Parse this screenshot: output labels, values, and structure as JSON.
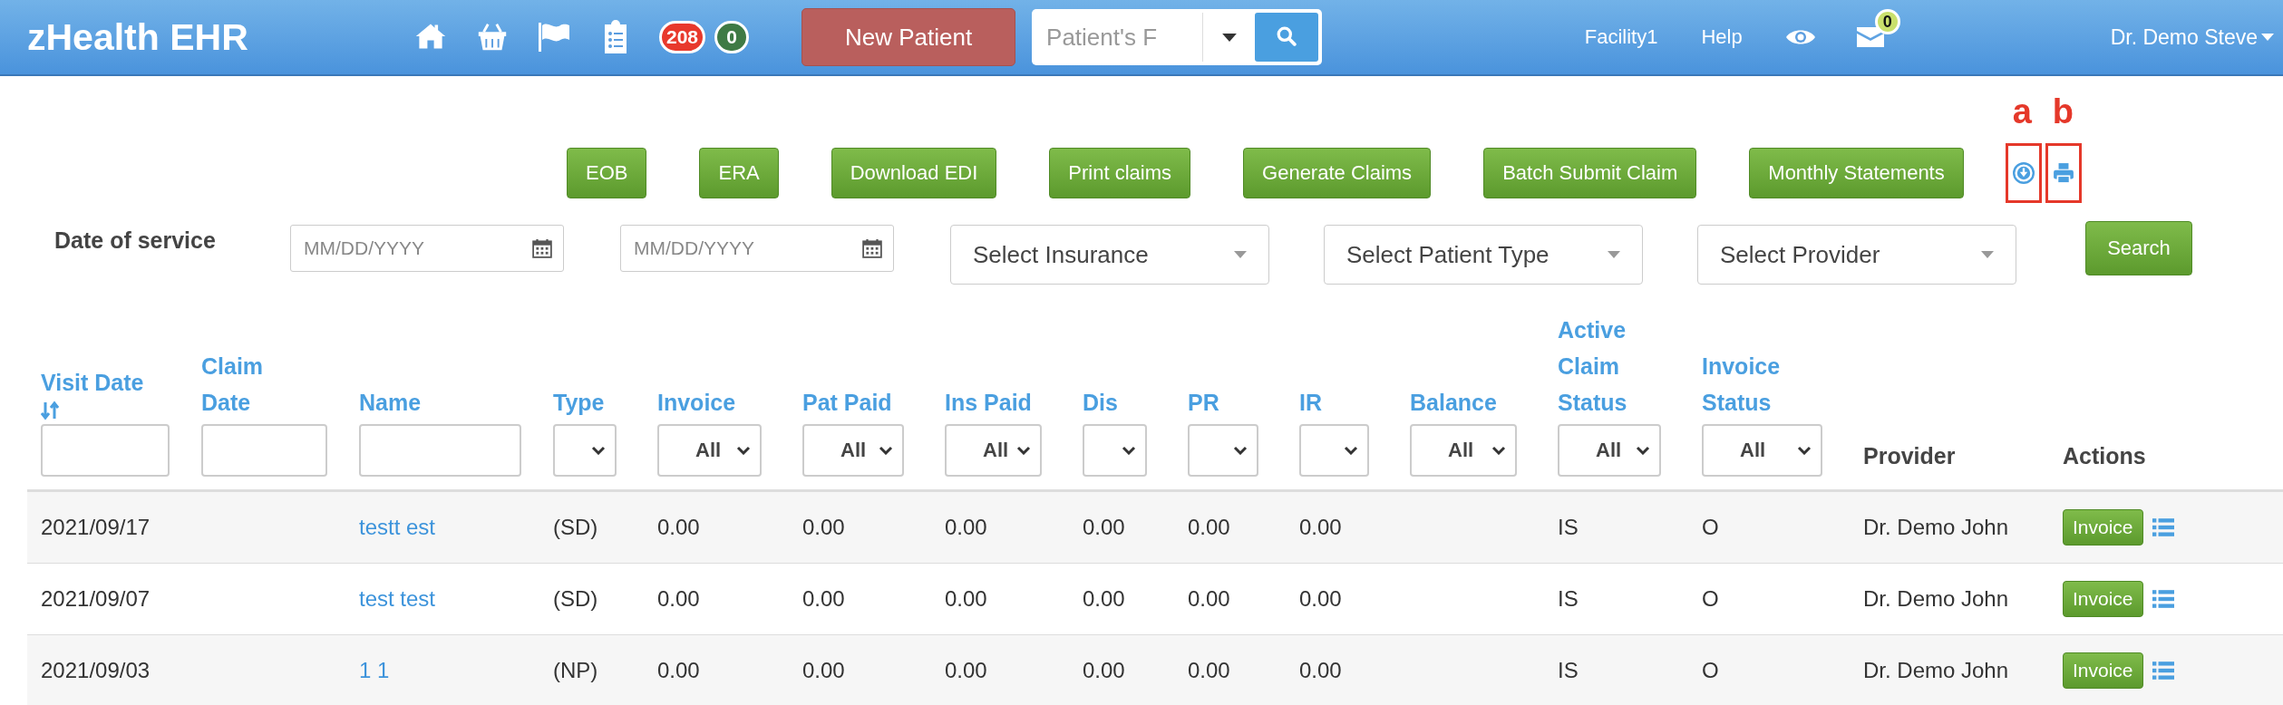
{
  "header": {
    "logo": "zHealth EHR",
    "badges": [
      {
        "text": "208",
        "color": "#e8392c"
      },
      {
        "text": "0",
        "color": "#3f7a45"
      }
    ],
    "new_patient_button": "New Patient",
    "search": {
      "placeholder": "Patient's F"
    },
    "facility": "Facility1",
    "help": "Help",
    "mail_badge": "0",
    "user": "Dr. Demo Steve"
  },
  "toolbar": {
    "buttons": [
      "EOB",
      "ERA",
      "Download EDI",
      "Print claims",
      "Generate Claims",
      "Batch Submit Claim",
      "Monthly Statements"
    ],
    "annotations": [
      {
        "label": "a",
        "kind": "download"
      },
      {
        "label": "b",
        "kind": "print"
      }
    ]
  },
  "filters": {
    "date_label": "Date of service",
    "date_fields": [
      {
        "placeholder": "MM/DD/YYYY"
      },
      {
        "placeholder": "MM/DD/YYYY"
      }
    ],
    "selects": [
      {
        "placeholder": "Select Insurance"
      },
      {
        "placeholder": "Select Patient Type"
      },
      {
        "placeholder": "Select Provider"
      }
    ],
    "search_button": "Search"
  },
  "table": {
    "columns": [
      {
        "label": "Visit Date",
        "link": true,
        "sort_icon": true,
        "filter": {
          "kind": "text"
        }
      },
      {
        "label": "Claim Date",
        "link": true,
        "sort_icon": false,
        "filter": {
          "kind": "text"
        }
      },
      {
        "label": "Name",
        "link": true,
        "sort_icon": false,
        "filter": {
          "kind": "text"
        }
      },
      {
        "label": "Type",
        "link": true,
        "sort_icon": false,
        "filter": {
          "kind": "select"
        }
      },
      {
        "label": "Invoice",
        "link": true,
        "sort_icon": false,
        "filter": {
          "kind": "select",
          "value": "All"
        }
      },
      {
        "label": "Pat Paid",
        "link": true,
        "sort_icon": false,
        "filter": {
          "kind": "select",
          "value": "All"
        }
      },
      {
        "label": "Ins Paid",
        "link": true,
        "sort_icon": false,
        "filter": {
          "kind": "select",
          "value": "All"
        }
      },
      {
        "label": "Dis",
        "link": true,
        "sort_icon": false,
        "filter": {
          "kind": "select"
        }
      },
      {
        "label": "PR",
        "link": true,
        "sort_icon": false,
        "filter": {
          "kind": "select"
        }
      },
      {
        "label": "IR",
        "link": true,
        "sort_icon": false,
        "filter": {
          "kind": "select"
        }
      },
      {
        "label": "Balance",
        "link": true,
        "sort_icon": false,
        "filter": {
          "kind": "select",
          "value": "All"
        }
      },
      {
        "label": "Active Claim Status",
        "link": true,
        "sort_icon": false,
        "filter": {
          "kind": "select",
          "value": "All"
        }
      },
      {
        "label": "Invoice Status",
        "link": true,
        "sort_icon": false,
        "filter": {
          "kind": "select",
          "value": "All"
        }
      },
      {
        "label": "Provider",
        "link": false,
        "sort_icon": false,
        "filter": {
          "kind": "none"
        }
      },
      {
        "label": "Actions",
        "link": false,
        "sort_icon": false,
        "filter": {
          "kind": "none"
        }
      }
    ],
    "rows": [
      {
        "cells": [
          "2021/09/17",
          null,
          "testt est",
          "(SD)",
          "0.00",
          "0.00",
          "0.00",
          "0.00",
          "0.00",
          "0.00",
          null,
          "IS",
          "O",
          "Dr. Demo John"
        ],
        "action_button": "Invoice"
      },
      {
        "cells": [
          "2021/09/07",
          null,
          "test test",
          "(SD)",
          "0.00",
          "0.00",
          "0.00",
          "0.00",
          "0.00",
          "0.00",
          null,
          "IS",
          "O",
          "Dr. Demo John"
        ],
        "action_button": "Invoice"
      },
      {
        "cells": [
          "2021/09/03",
          null,
          "1 1",
          "(NP)",
          "0.00",
          "0.00",
          "0.00",
          "0.00",
          "0.00",
          "0.00",
          null,
          "IS",
          "O",
          "Dr. Demo John"
        ],
        "action_button": "Invoice"
      }
    ]
  }
}
